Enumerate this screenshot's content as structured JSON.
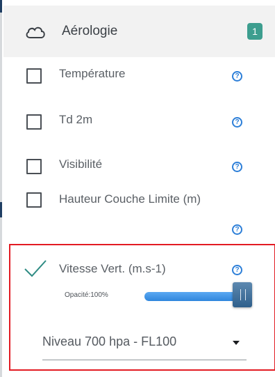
{
  "header": {
    "title": "Aérologie",
    "count": "1",
    "icon": "cloud-outline-icon"
  },
  "layers": [
    {
      "label": "Température",
      "checked": false,
      "help": "?"
    },
    {
      "label": "Td 2m",
      "checked": false,
      "help": "?"
    },
    {
      "label": "Visibilité",
      "checked": false,
      "help": "?"
    },
    {
      "label": "Hauteur Couche Limite (m)",
      "checked": false,
      "help": "?"
    },
    {
      "label": "Vitesse Vert. (m.s-1)",
      "checked": true,
      "help": "?"
    }
  ],
  "opacity": {
    "label": "Opacité:100%",
    "value_percent": 100
  },
  "level_select": {
    "value": "Niveau 700 hpa - FL100"
  },
  "colors": {
    "accent_teal": "#3d9e8f",
    "help_blue": "#2d7fd8",
    "selection_red": "#e21b23",
    "check_teal": "#2f8c84"
  }
}
